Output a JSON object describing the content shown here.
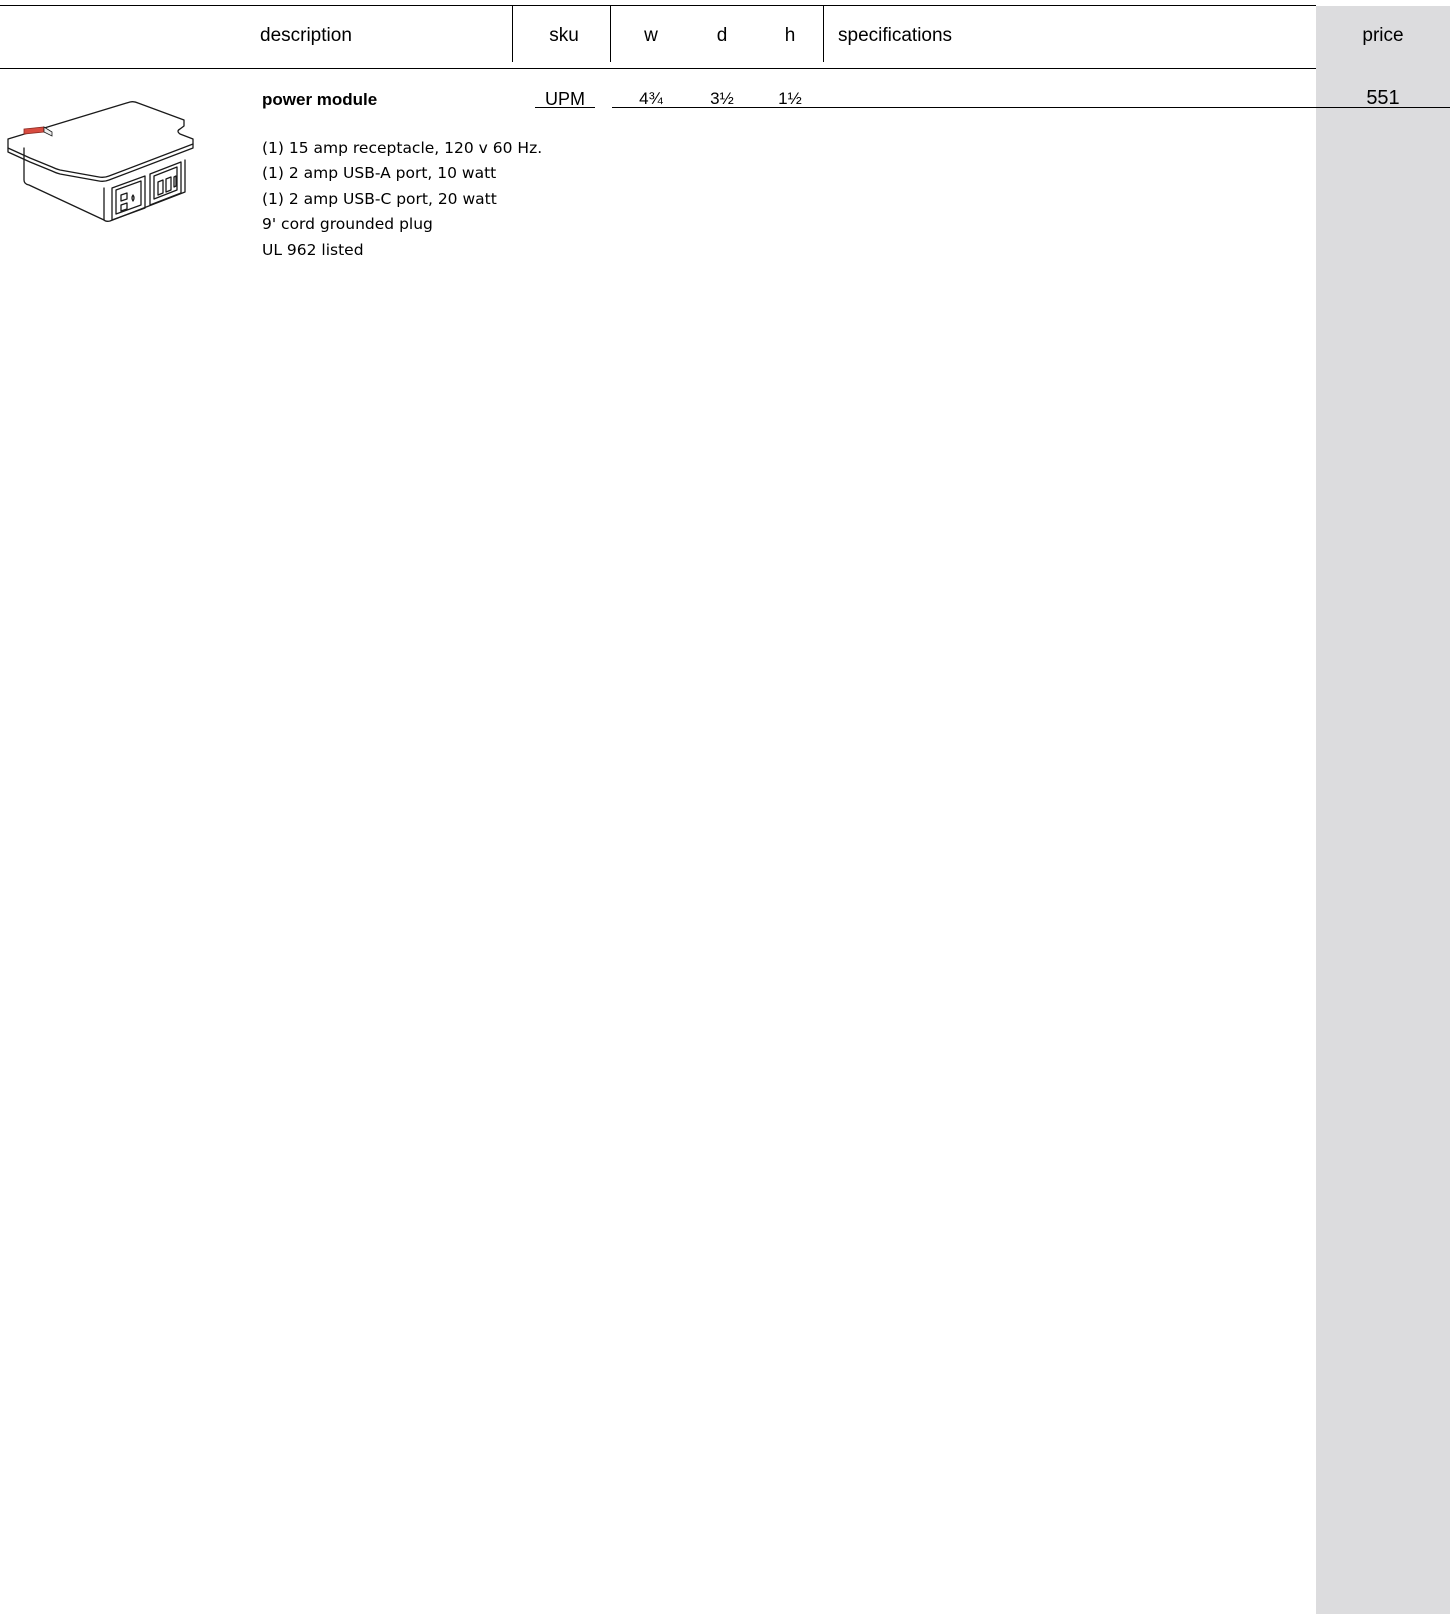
{
  "table": {
    "headers": {
      "description": "description",
      "sku": "sku",
      "w": "w",
      "d": "d",
      "h": "h",
      "specifications": "specifications",
      "price": "price"
    },
    "rows": [
      {
        "name": "power module",
        "sku": "UPM",
        "w": "4¾",
        "d": "3½",
        "h": "1½",
        "price": "551",
        "details": [
          "(1) 15 amp receptacle, 120 v 60 Hz.",
          "(1) 2 amp USB-A port, 10 watt",
          "(1) 2 amp USB-C port, 20 watt",
          "9'  cord grounded plug",
          "UL 962 listed"
        ],
        "image_icon": "power-module-drawing"
      }
    ]
  },
  "colors": {
    "price_band": "#dcdcde",
    "accent_red": "#d84b3f",
    "rule": "#000000"
  }
}
